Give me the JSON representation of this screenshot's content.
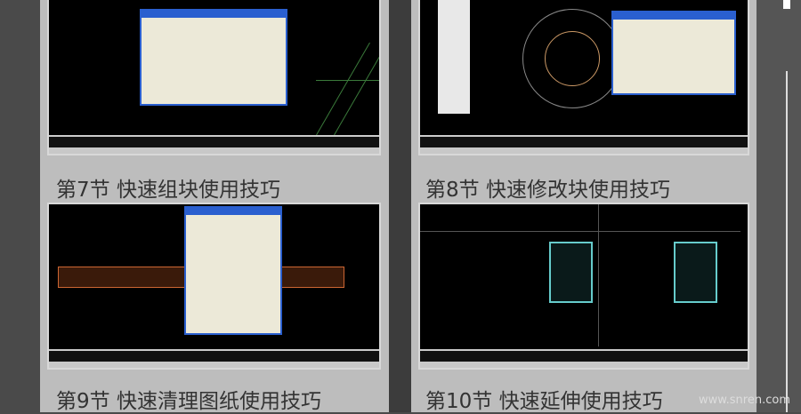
{
  "lessons": [
    {
      "title": "第7节 快速组块使用技巧"
    },
    {
      "title": "第8节 快速修改块使用技巧"
    },
    {
      "title": "第9节 快速清理图纸使用技巧"
    },
    {
      "title": "第10节 快速延伸使用技巧"
    }
  ],
  "watermark": "www.snren.com"
}
